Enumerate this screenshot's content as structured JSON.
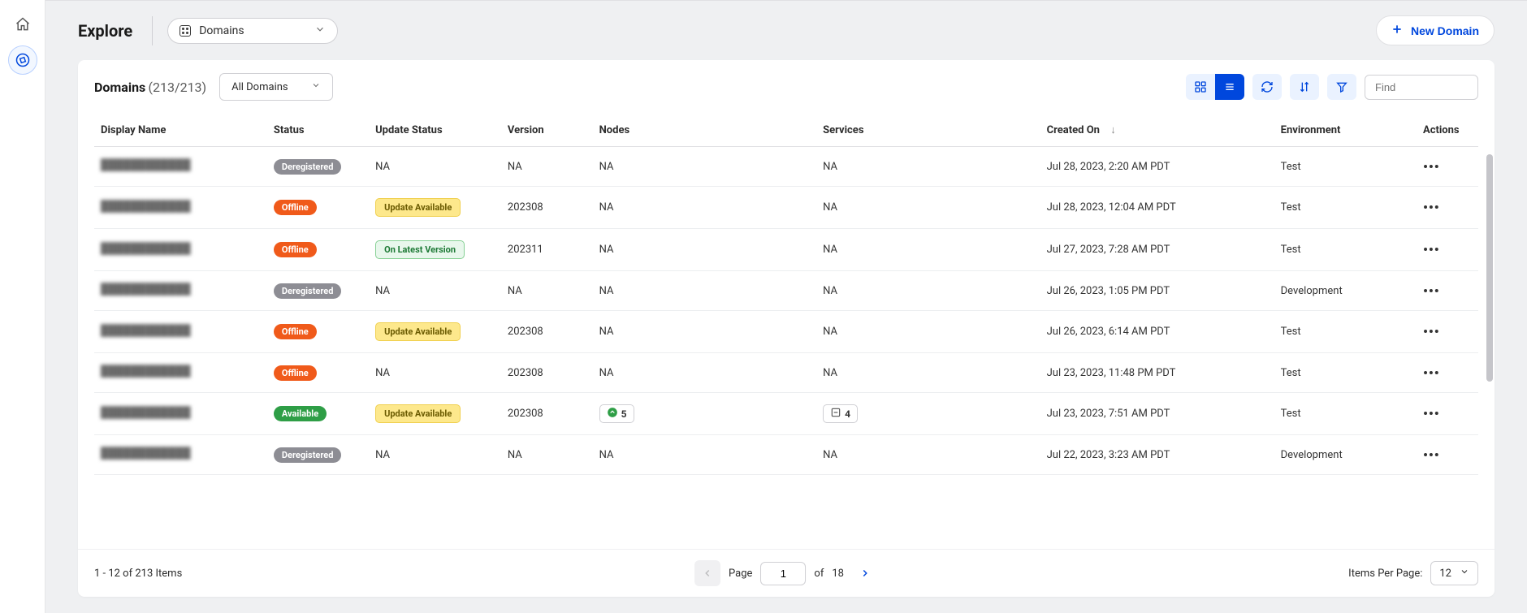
{
  "header": {
    "title": "Explore",
    "picker_label": "Domains",
    "new_button_label": "New Domain"
  },
  "section": {
    "title": "Domains",
    "count_display": "(213/213)",
    "filter_label": "All Domains",
    "find_placeholder": "Find"
  },
  "columns": {
    "display_name": "Display Name",
    "status": "Status",
    "update_status": "Update Status",
    "version": "Version",
    "nodes": "Nodes",
    "services": "Services",
    "created_on": "Created On",
    "sort_indicator": "↓",
    "environment": "Environment",
    "actions": "Actions"
  },
  "status_labels": {
    "deregistered": "Deregistered",
    "offline": "Offline",
    "available": "Available"
  },
  "update_labels": {
    "update_available": "Update Available",
    "on_latest": "On Latest Version"
  },
  "rows": [
    {
      "status": "deregistered",
      "update": "na",
      "version": "NA",
      "nodes": "NA",
      "services": "NA",
      "created": "Jul 28, 2023, 2:20 AM PDT",
      "env": "Test"
    },
    {
      "status": "offline",
      "update": "update",
      "version": "202308",
      "nodes": "NA",
      "services": "NA",
      "created": "Jul 28, 2023, 12:04 AM PDT",
      "env": "Test"
    },
    {
      "status": "offline",
      "update": "latest",
      "version": "202311",
      "nodes": "NA",
      "services": "NA",
      "created": "Jul 27, 2023, 7:28 AM PDT",
      "env": "Test"
    },
    {
      "status": "deregistered",
      "update": "na",
      "version": "NA",
      "nodes": "NA",
      "services": "NA",
      "created": "Jul 26, 2023, 1:05 PM PDT",
      "env": "Development"
    },
    {
      "status": "offline",
      "update": "update",
      "version": "202308",
      "nodes": "NA",
      "services": "NA",
      "created": "Jul 26, 2023, 6:14 AM PDT",
      "env": "Test"
    },
    {
      "status": "offline",
      "update": "na",
      "version": "202308",
      "nodes": "NA",
      "services": "NA",
      "created": "Jul 23, 2023, 11:48 PM PDT",
      "env": "Test"
    },
    {
      "status": "available",
      "update": "update",
      "version": "202308",
      "nodes": "5",
      "services": "4",
      "created": "Jul 23, 2023, 7:51 AM PDT",
      "env": "Test"
    },
    {
      "status": "deregistered",
      "update": "na",
      "version": "NA",
      "nodes": "NA",
      "services": "NA",
      "created": "Jul 22, 2023, 3:23 AM PDT",
      "env": "Development"
    }
  ],
  "na_text": "NA",
  "pagination": {
    "range_text": "1 - 12 of 213 Items",
    "page_label": "Page",
    "current_page": "1",
    "of_label": "of",
    "total_pages": "18",
    "items_per_label": "Items Per Page:",
    "items_per_value": "12"
  }
}
